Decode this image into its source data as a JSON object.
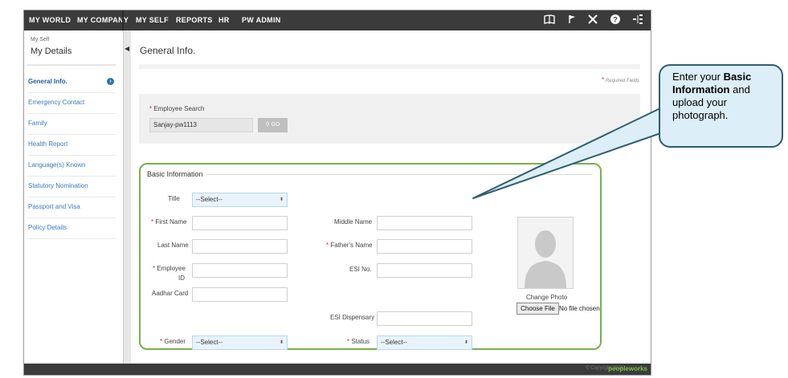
{
  "nav": {
    "items": [
      "MY WORLD",
      "MY COMPANY",
      "MY SELF",
      "REPORTS",
      "HR",
      "PW ADMIN"
    ],
    "icons": [
      "book-icon",
      "flag-icon",
      "tools-icon",
      "help-icon",
      "sitemap-icon"
    ]
  },
  "sidebar": {
    "small_title": "My Self",
    "title": "My Details",
    "items": [
      "General Info.",
      "Emergency Contact",
      "Family",
      "Health Report",
      "Language(s) Known",
      "Statutory Nomination",
      "Passport and Visa",
      "Policy Details"
    ]
  },
  "page": {
    "title": "General Info.",
    "required_note": "Required Fields"
  },
  "search": {
    "label": "Employee Search",
    "value": "Sanjay-pw1113",
    "go_label": "GO"
  },
  "basic": {
    "legend": "Basic Information",
    "title_label": "Title",
    "title_value": "--Select--",
    "first_name_label": "First Name",
    "middle_name_label": "Middle Name",
    "last_name_label": "Last Name",
    "fathers_name_label": "Father's Name",
    "employee_label_1": "Employee",
    "employee_label_2": "ID",
    "esi_no_label": "ESI No.",
    "aadhar_label": "Aadhar Card",
    "esi_dispensary_label": "ESI Dispensary",
    "gender_label": "Gender",
    "gender_value": "--Select--",
    "status_label": "Status",
    "status_value": "--Select--"
  },
  "photo": {
    "change_label": "Change Photo",
    "choose_button": "Choose File",
    "no_file": "No file chosen"
  },
  "footer": {
    "copyright": "© Copyright 2015",
    "logo": "peopleworks"
  },
  "callout": {
    "line1_pre": "Enter your ",
    "line1_bold": "Basic",
    "line2_bold": "Information",
    "line2_post": " and",
    "line3": "upload your",
    "line4": "photograph."
  },
  "colors": {
    "topbar": "#3b3b3b",
    "link": "#3a7bbf",
    "fieldset_border": "#77b050",
    "required_star": "#d9262a",
    "callout_bg": "#dceef7",
    "callout_border": "#2e5e6e"
  }
}
